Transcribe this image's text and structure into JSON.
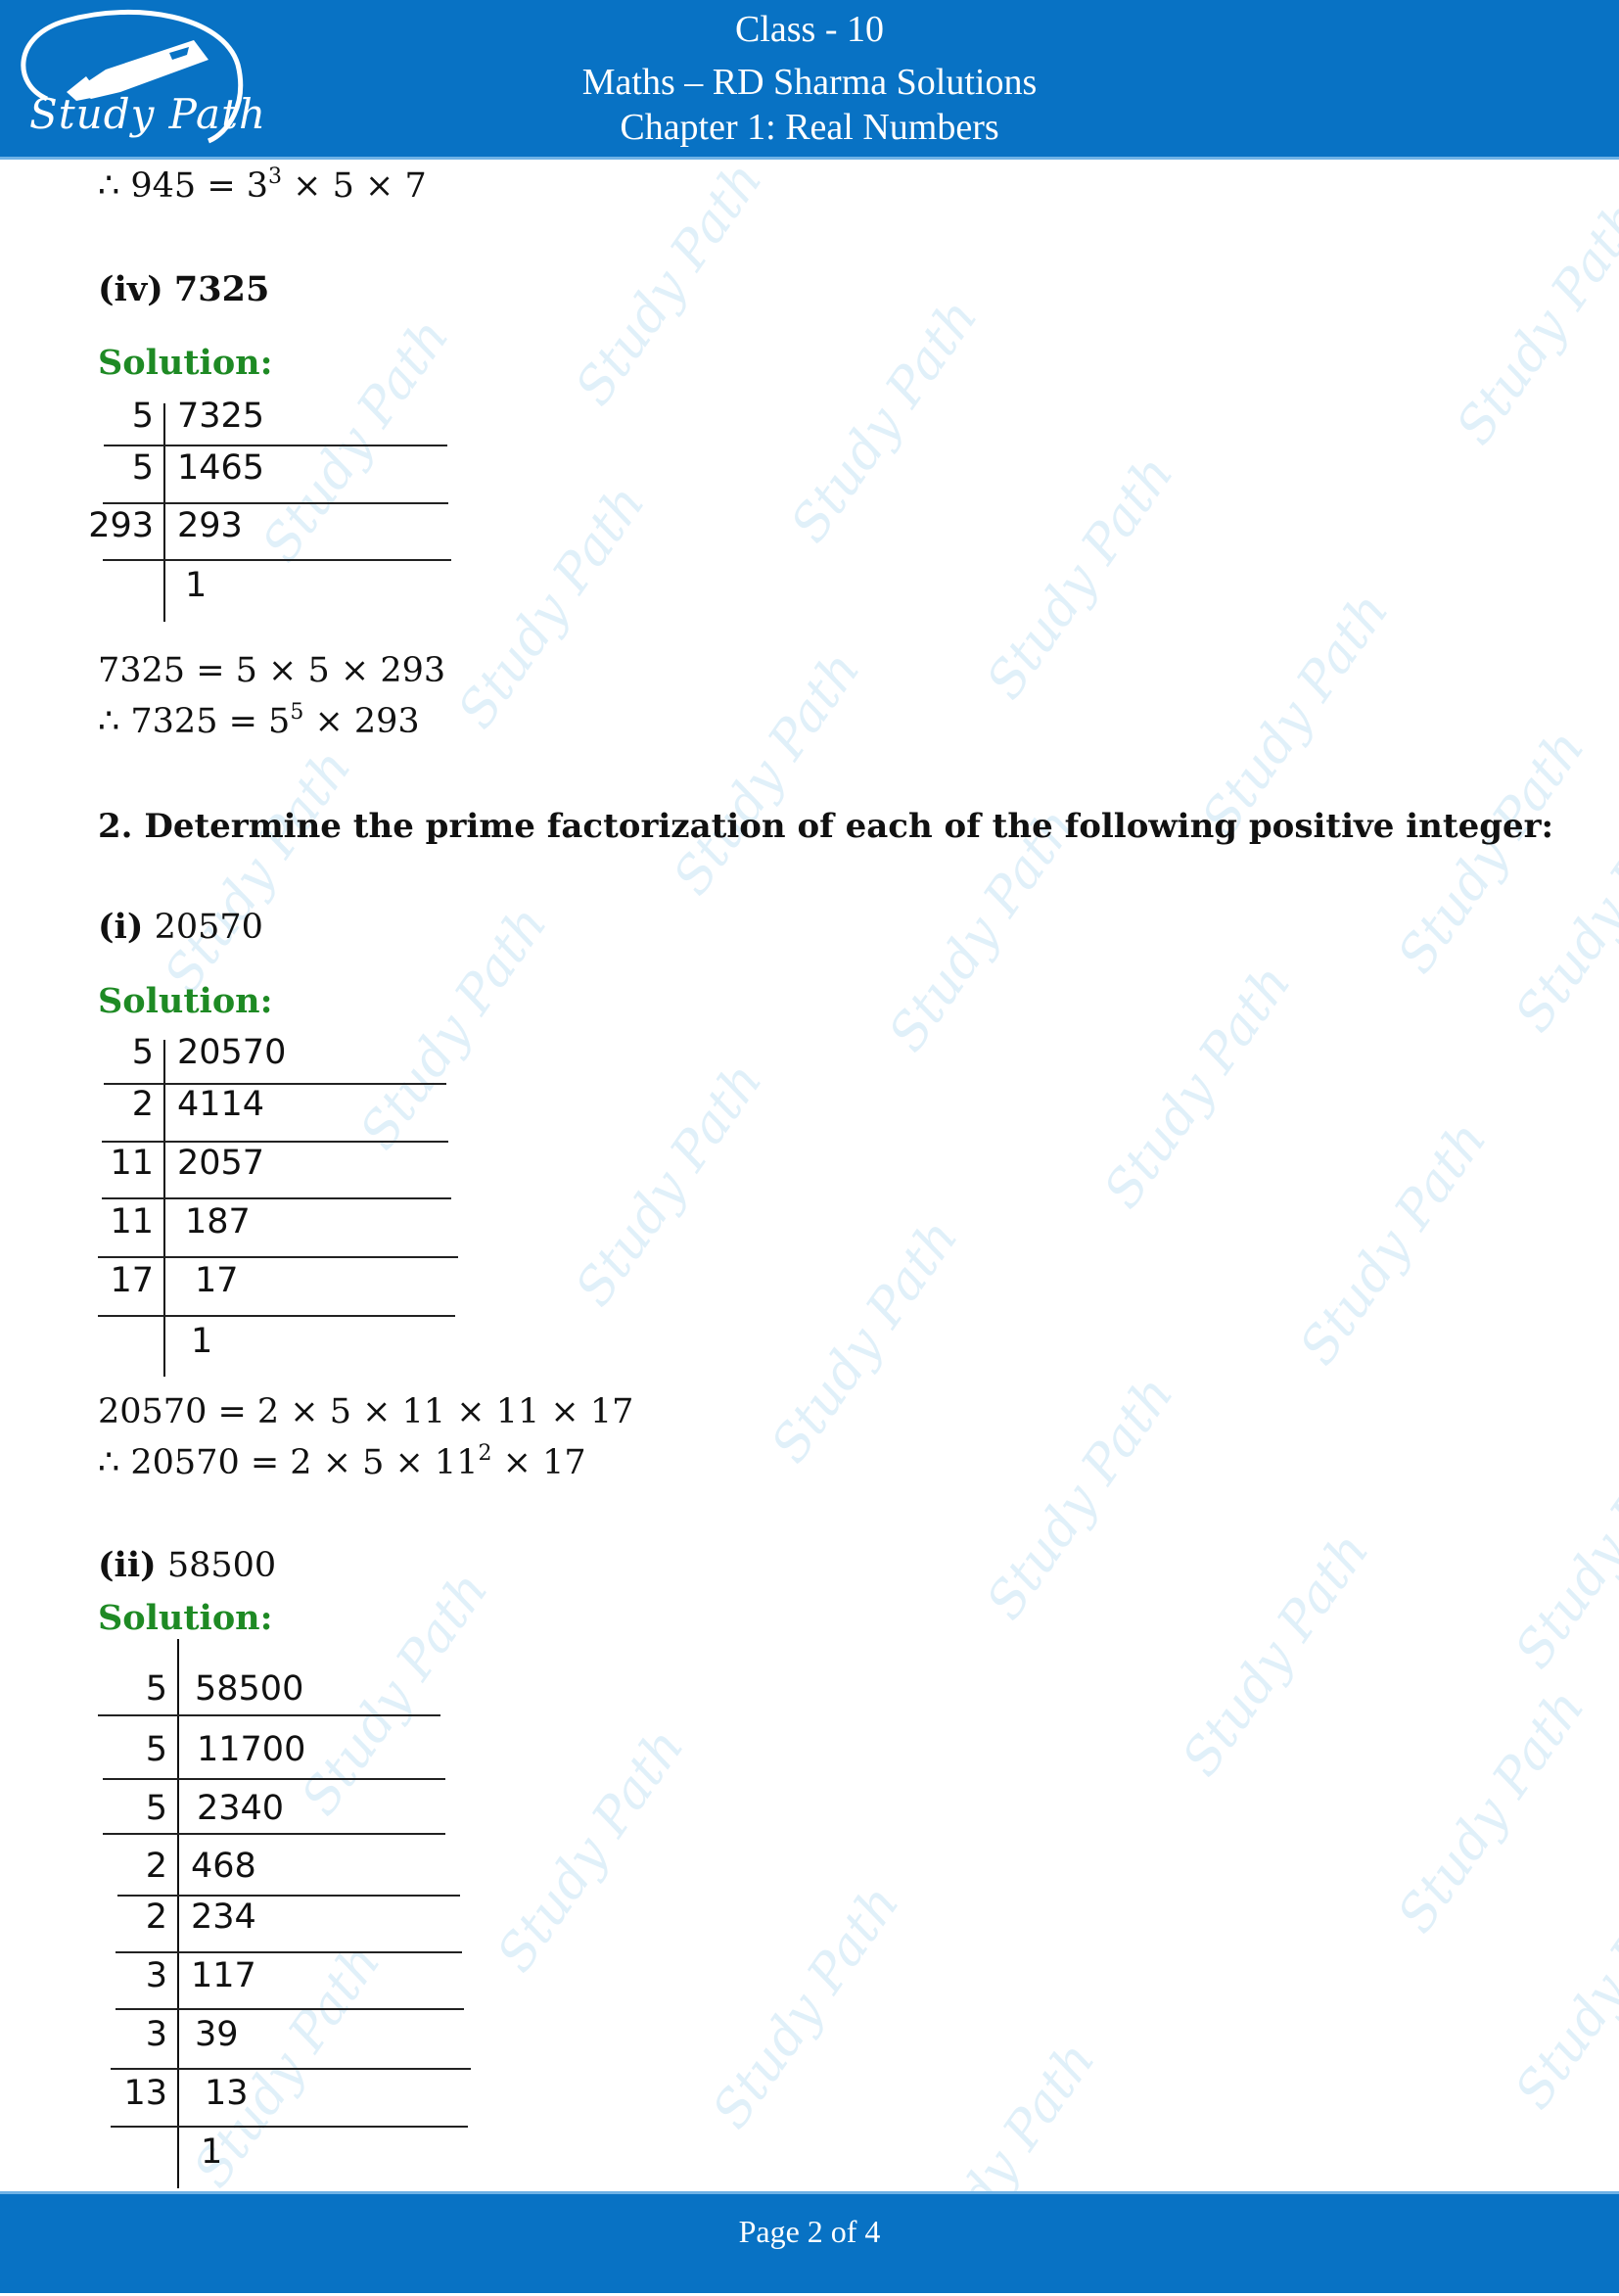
{
  "header": {
    "logo_text": "Study Path",
    "class_line": "Class - 10",
    "subject_line": "Maths – RD Sharma Solutions",
    "chapter_line": "Chapter 1: Real Numbers"
  },
  "watermark_text": "Study Path",
  "content": {
    "carry_over": "∴ 945 = 3",
    "carry_over_exp": "3",
    "carry_over_tail": " × 5 × 7",
    "part_iv": {
      "label": "(iv)",
      "number": "7325",
      "solution_label": "Solution:",
      "division": [
        {
          "divisor": "5",
          "dividend": "7325"
        },
        {
          "divisor": "5",
          "dividend": "1465"
        },
        {
          "divisor": "293",
          "dividend": "293"
        },
        {
          "divisor": "",
          "dividend": "1"
        }
      ],
      "result_line1": "7325 = 5 × 5 × 293",
      "result_line2_prefix": "∴ 7325 = 5",
      "result_line2_exp": "5",
      "result_line2_tail": " × 293"
    },
    "question2": "2. Determine the prime factorization of each of the following positive integer:",
    "part_i": {
      "label": "(i)",
      "number": "20570",
      "solution_label": "Solution:",
      "division": [
        {
          "divisor": "5",
          "dividend": "20570"
        },
        {
          "divisor": "2",
          "dividend": "4114"
        },
        {
          "divisor": "11",
          "dividend": "2057"
        },
        {
          "divisor": "11",
          "dividend": "187"
        },
        {
          "divisor": "17",
          "dividend": "17"
        },
        {
          "divisor": "",
          "dividend": "1"
        }
      ],
      "result_line1": "20570 = 2 × 5 × 11 × 11 × 17",
      "result_line2_prefix": "∴ 20570 = 2 × 5 × 11",
      "result_line2_exp": "2",
      "result_line2_tail": " × 17"
    },
    "part_ii": {
      "label": "(ii)",
      "number": "58500",
      "solution_label": "Solution:",
      "division": [
        {
          "divisor": "5",
          "dividend": "58500"
        },
        {
          "divisor": "5",
          "dividend": "11700"
        },
        {
          "divisor": "5",
          "dividend": "2340"
        },
        {
          "divisor": "2",
          "dividend": "468"
        },
        {
          "divisor": "2",
          "dividend": "234"
        },
        {
          "divisor": "3",
          "dividend": "117"
        },
        {
          "divisor": "3",
          "dividend": "39"
        },
        {
          "divisor": "13",
          "dividend": "13"
        },
        {
          "divisor": "",
          "dividend": "1"
        }
      ]
    }
  },
  "footer": {
    "page_prefix": "Page ",
    "current_page": "2",
    "of_label": " of ",
    "total_pages": "4"
  }
}
